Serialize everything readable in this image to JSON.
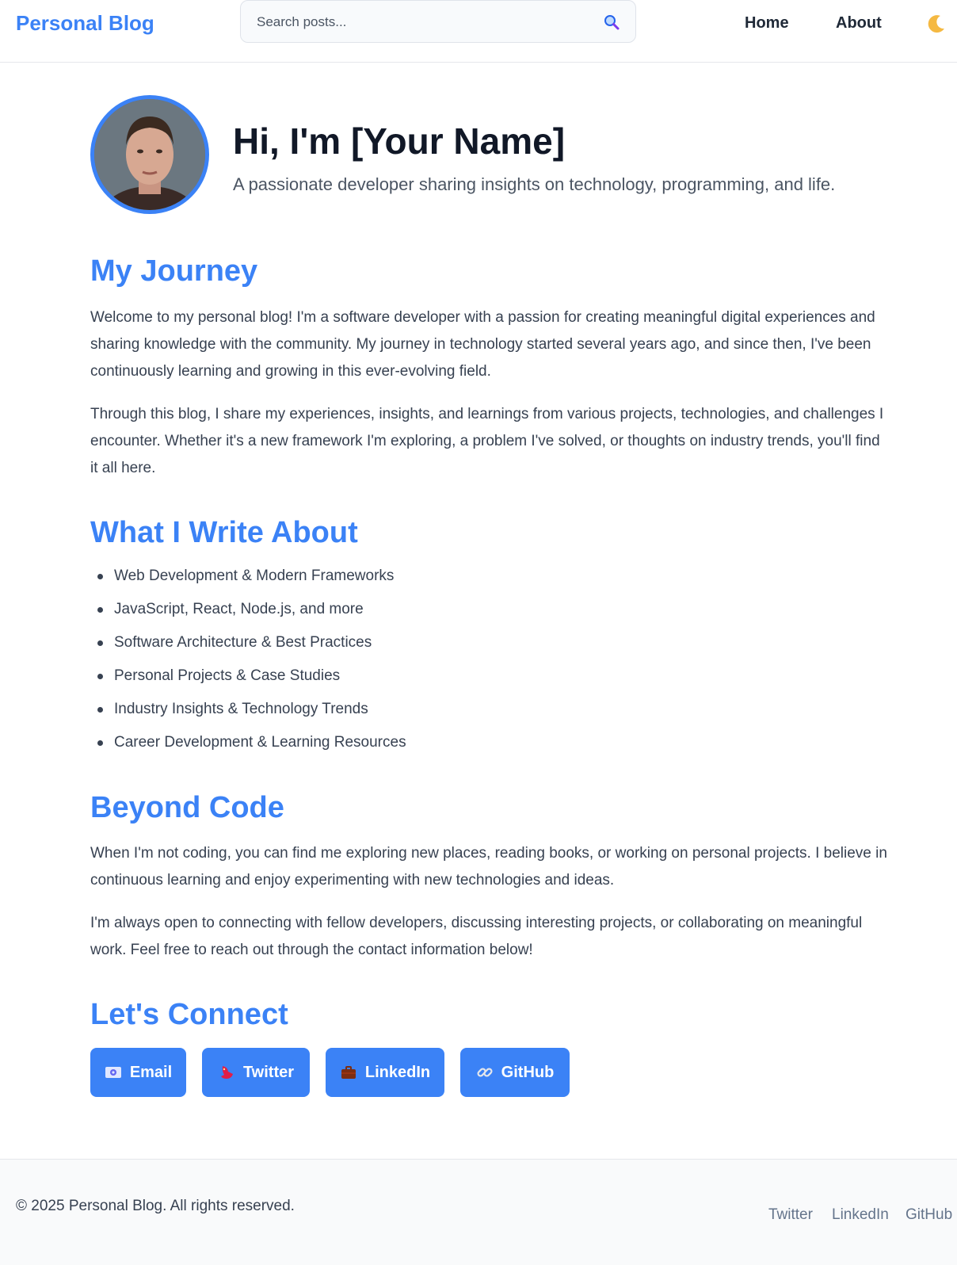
{
  "header": {
    "brand": "Personal Blog",
    "search_placeholder": "Search posts...",
    "nav": [
      {
        "label": "Home"
      },
      {
        "label": "About"
      }
    ],
    "theme_icon": "moon-icon"
  },
  "hero": {
    "title": "Hi, I'm [Your Name]",
    "subtitle": "A passionate developer sharing insights on technology, programming, and life."
  },
  "sections": {
    "journey": {
      "heading": "My Journey",
      "paragraphs": [
        "Welcome to my personal blog! I'm a software developer with a passion for creating meaningful digital experiences and sharing knowledge with the community. My journey in technology started several years ago, and since then, I've been continuously learning and growing in this ever-evolving field.",
        "Through this blog, I share my experiences, insights, and learnings from various projects, technologies, and challenges I encounter. Whether it's a new framework I'm exploring, a problem I've solved, or thoughts on industry trends, you'll find it all here."
      ]
    },
    "topics": {
      "heading": "What I Write About",
      "items": [
        "Web Development & Modern Frameworks",
        "JavaScript, React, Node.js, and more",
        "Software Architecture & Best Practices",
        "Personal Projects & Case Studies",
        "Industry Insights & Technology Trends",
        "Career Development & Learning Resources"
      ]
    },
    "beyond": {
      "heading": "Beyond Code",
      "paragraphs": [
        "When I'm not coding, you can find me exploring new places, reading books, or working on personal projects. I believe in continuous learning and enjoy experimenting with new technologies and ideas.",
        "I'm always open to connecting with fellow developers, discussing interesting projects, or collaborating on meaningful work. Feel free to reach out through the contact information below!"
      ]
    },
    "connect": {
      "heading": "Let's Connect",
      "buttons": [
        {
          "label": "Email",
          "icon": "email-icon"
        },
        {
          "label": "Twitter",
          "icon": "bird-icon"
        },
        {
          "label": "LinkedIn",
          "icon": "briefcase-icon"
        },
        {
          "label": "GitHub",
          "icon": "link-icon"
        }
      ]
    }
  },
  "footer": {
    "copyright": "© 2025 Personal Blog. All rights reserved.",
    "links": [
      "Twitter",
      "LinkedIn",
      "GitHub"
    ]
  },
  "colors": {
    "accent": "#3b82f6",
    "text": "#374151",
    "heading": "#111827"
  }
}
